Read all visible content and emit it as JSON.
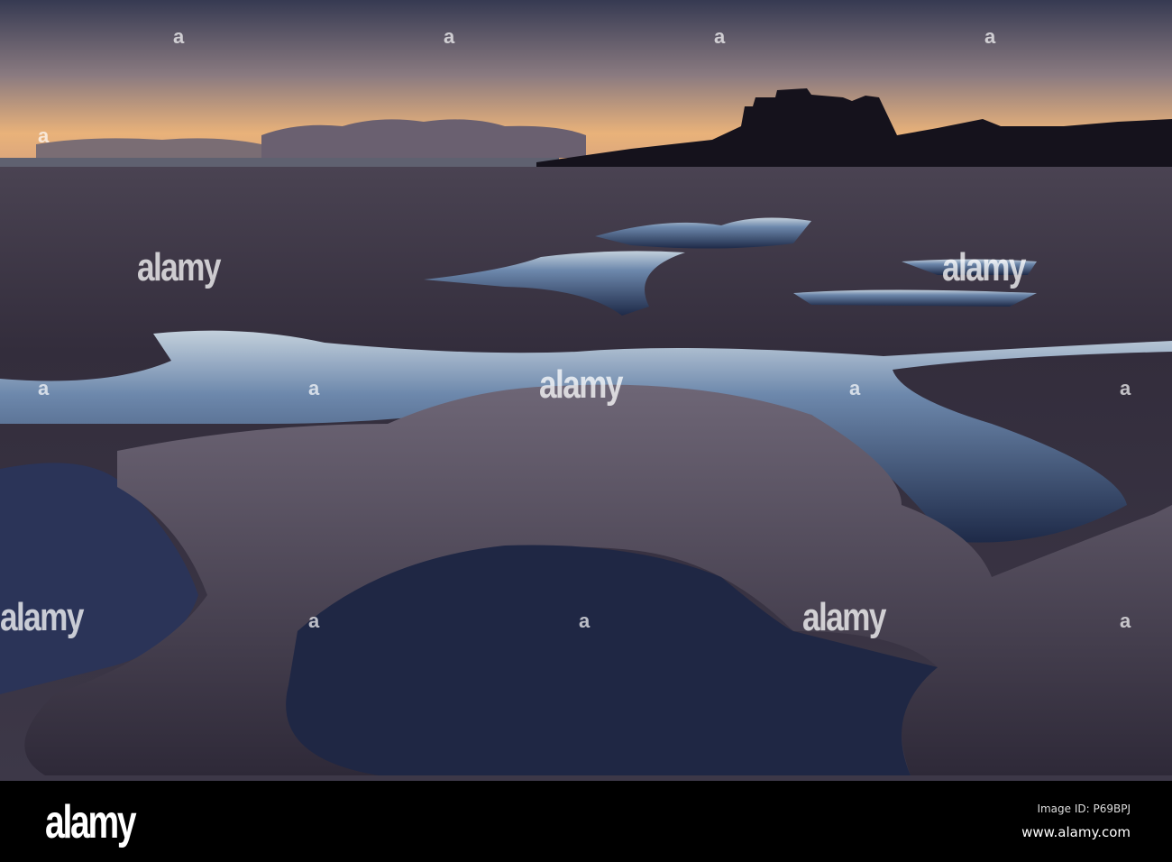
{
  "photo": {
    "subject": "castle silhouette over beach tide pools at dawn",
    "colors": {
      "sky_top": "#363a52",
      "sky_horizon": "#e9b27a",
      "sand": "#3a3545",
      "pool": "#5f7aa0",
      "pool_light": "#b9c9d8"
    }
  },
  "watermark": {
    "text": "alamy",
    "mark": "a"
  },
  "footer": {
    "logo": "alamy",
    "image_id": "Image ID: P69BPJ",
    "url": "www.alamy.com"
  }
}
